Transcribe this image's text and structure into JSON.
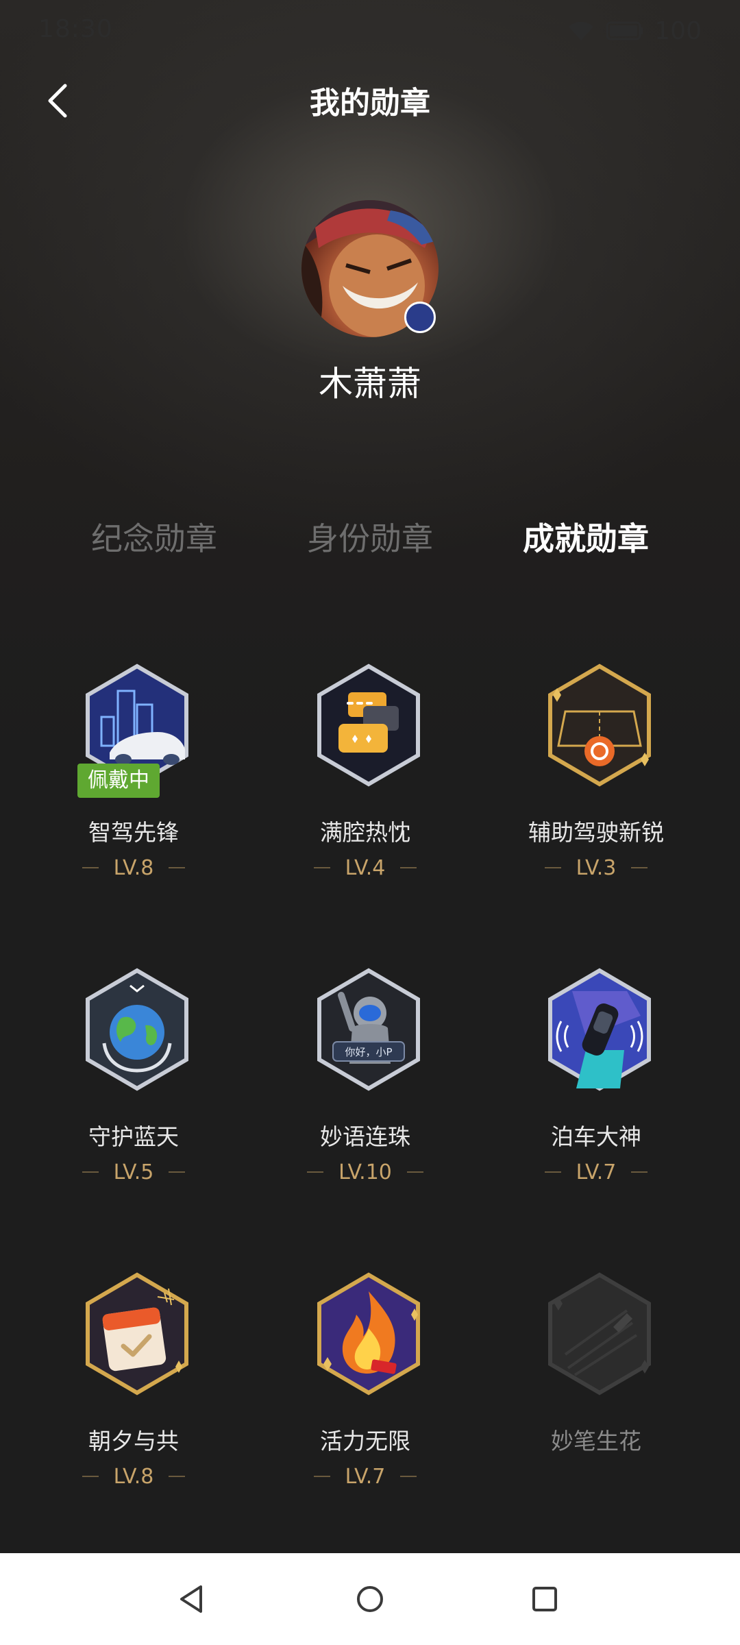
{
  "status_bar": {
    "time": "18:30",
    "battery": "100"
  },
  "header": {
    "title": "我的勋章"
  },
  "profile": {
    "username": "木萧萧"
  },
  "tabs": [
    {
      "label": "纪念勋章",
      "active": false
    },
    {
      "label": "身份勋章",
      "active": false
    },
    {
      "label": "成就勋章",
      "active": true
    }
  ],
  "badges": [
    {
      "name": "智驾先锋",
      "level": "LV.8",
      "wearing_label": "佩戴中",
      "icon": "city-car-icon"
    },
    {
      "name": "满腔热忱",
      "level": "LV.4",
      "icon": "chat-bubbles-icon"
    },
    {
      "name": "辅助驾驶新锐",
      "level": "LV.3",
      "icon": "road-steering-icon"
    },
    {
      "name": "守护蓝天",
      "level": "LV.5",
      "icon": "earth-hands-icon"
    },
    {
      "name": "妙语连珠",
      "level": "LV.10",
      "icon": "astronaut-icon",
      "icon_text": "你好，小P"
    },
    {
      "name": "泊车大神",
      "level": "LV.7",
      "icon": "parking-car-icon"
    },
    {
      "name": "朝夕与共",
      "level": "LV.8",
      "icon": "calendar-check-icon"
    },
    {
      "name": "活力无限",
      "level": "LV.7",
      "icon": "flame-icon"
    },
    {
      "name": "妙笔生花",
      "level": "",
      "locked": true,
      "icon": "pen-locked-icon"
    }
  ],
  "colors": {
    "background": "#1e1e1e",
    "level_gold": "#c8a46a",
    "wearing_green": "#5fa831",
    "tab_inactive": "#6e6e6e"
  }
}
